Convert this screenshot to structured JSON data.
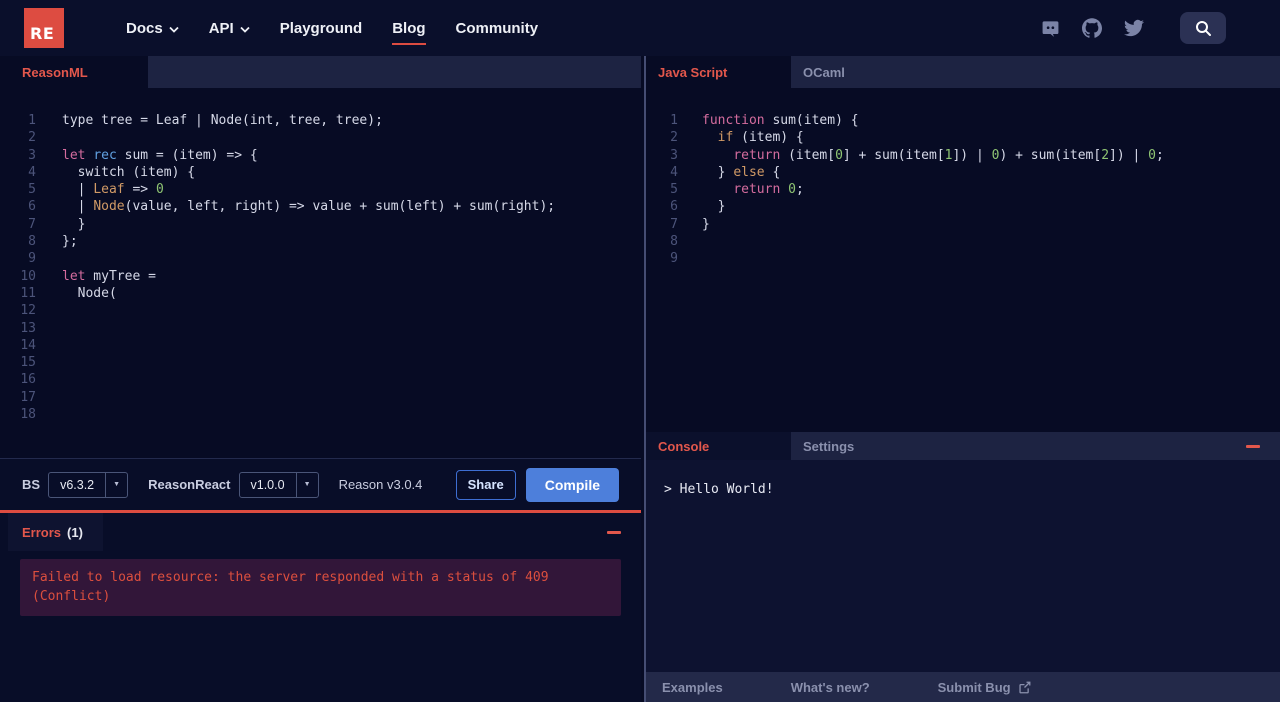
{
  "navbar": {
    "logo_text": "RE",
    "items": [
      {
        "label": "Docs",
        "caret": true,
        "active": false
      },
      {
        "label": "API",
        "caret": true,
        "active": false
      },
      {
        "label": "Playground",
        "caret": false,
        "active": false
      },
      {
        "label": "Blog",
        "caret": false,
        "active": true
      },
      {
        "label": "Community",
        "caret": false,
        "active": false
      }
    ],
    "social_icons": [
      "discord-icon",
      "github-icon",
      "twitter-icon"
    ]
  },
  "colors": {
    "accent_red": "#dd4c41",
    "active_tab_text": "#e2574c",
    "compile_blue": "#4d7fdb",
    "error_text": "#dc4f3e",
    "error_box_bg": "#321639",
    "keyword_pink": "#d46c9e",
    "keyword_blue": "#61a0e1",
    "constructor_orange": "#d19a66",
    "number_green": "#8fc573"
  },
  "reason_editor": {
    "tab_label": "ReasonML",
    "lines": [
      [
        {
          "t": "type tree = Leaf | Node(int, tree, tree);",
          "c": "plain"
        }
      ],
      [],
      [
        {
          "t": "let",
          "c": "pink"
        },
        {
          "t": " ",
          "c": "plain"
        },
        {
          "t": "rec",
          "c": "blue"
        },
        {
          "t": " sum = (item) => {",
          "c": "plain"
        }
      ],
      [
        {
          "t": "  switch (item) {",
          "c": "plain"
        }
      ],
      [
        {
          "t": "  | ",
          "c": "plain"
        },
        {
          "t": "Leaf",
          "c": "orange"
        },
        {
          "t": " => ",
          "c": "plain"
        },
        {
          "t": "0",
          "c": "green"
        }
      ],
      [
        {
          "t": "  | ",
          "c": "plain"
        },
        {
          "t": "Node",
          "c": "orange"
        },
        {
          "t": "(value, left, right) => value + sum(left) + sum(right);",
          "c": "plain"
        }
      ],
      [
        {
          "t": "  }",
          "c": "plain"
        }
      ],
      [
        {
          "t": "};",
          "c": "plain"
        }
      ],
      [],
      [
        {
          "t": "let",
          "c": "pink"
        },
        {
          "t": " myTree =",
          "c": "plain"
        }
      ],
      [
        {
          "t": "  Node(",
          "c": "plain"
        }
      ],
      [],
      [],
      [],
      [],
      [],
      [],
      []
    ]
  },
  "js_editor": {
    "tabs": [
      {
        "label": "Java Script",
        "active": true
      },
      {
        "label": "OCaml",
        "active": false
      }
    ],
    "lines": [
      [
        {
          "t": "function",
          "c": "pink"
        },
        {
          "t": " sum(item) {",
          "c": "plain"
        }
      ],
      [
        {
          "t": "  ",
          "c": "plain"
        },
        {
          "t": "if",
          "c": "orange"
        },
        {
          "t": " (item) {",
          "c": "plain"
        }
      ],
      [
        {
          "t": "    ",
          "c": "plain"
        },
        {
          "t": "return",
          "c": "pink"
        },
        {
          "t": " (item[",
          "c": "plain"
        },
        {
          "t": "0",
          "c": "green"
        },
        {
          "t": "] + sum(item[",
          "c": "plain"
        },
        {
          "t": "1",
          "c": "green"
        },
        {
          "t": "]) | ",
          "c": "plain"
        },
        {
          "t": "0",
          "c": "green"
        },
        {
          "t": ") + sum(item[",
          "c": "plain"
        },
        {
          "t": "2",
          "c": "green"
        },
        {
          "t": "]) | ",
          "c": "plain"
        },
        {
          "t": "0",
          "c": "green"
        },
        {
          "t": ";",
          "c": "plain"
        }
      ],
      [
        {
          "t": "  } ",
          "c": "plain"
        },
        {
          "t": "else",
          "c": "orange"
        },
        {
          "t": " {",
          "c": "plain"
        }
      ],
      [
        {
          "t": "    ",
          "c": "plain"
        },
        {
          "t": "return",
          "c": "pink"
        },
        {
          "t": " ",
          "c": "plain"
        },
        {
          "t": "0",
          "c": "green"
        },
        {
          "t": ";",
          "c": "plain"
        }
      ],
      [
        {
          "t": "  }",
          "c": "plain"
        }
      ],
      [
        {
          "t": "}",
          "c": "plain"
        }
      ],
      [],
      []
    ]
  },
  "toolbar": {
    "bs_label": "BS",
    "bs_version": "v6.3.2",
    "reason_react_label": "ReasonReact",
    "reason_react_version": "v1.0.0",
    "reason_version_text": "Reason v3.0.4",
    "share_label": "Share",
    "compile_label": "Compile"
  },
  "errors_panel": {
    "title": "Errors",
    "count": "(1)",
    "message": "Failed to load resource: the server responded with a status of 409 (Conflict)"
  },
  "console_panel": {
    "tabs": [
      {
        "label": "Console",
        "active": true
      },
      {
        "label": "Settings",
        "active": false
      }
    ],
    "output": "> Hello World!"
  },
  "footer": {
    "links": [
      {
        "label": "Examples",
        "external_icon": false
      },
      {
        "label": "What's new?",
        "external_icon": false
      },
      {
        "label": "Submit Bug",
        "external_icon": true
      }
    ]
  }
}
